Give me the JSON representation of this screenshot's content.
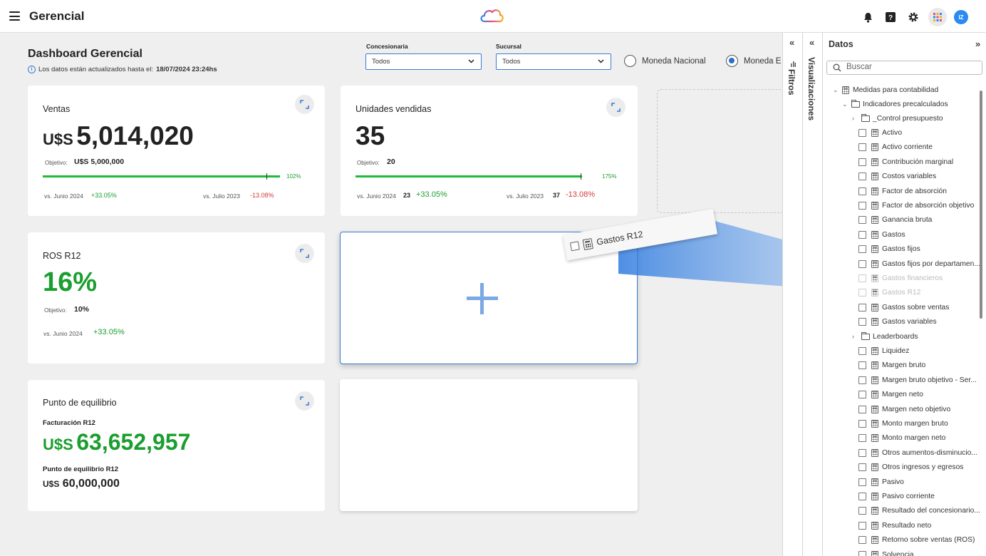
{
  "topbar": {
    "title": "Gerencial",
    "avatar": "IZ"
  },
  "header": {
    "title": "Dashboard Gerencial",
    "updated_prefix": "Los datos están actualizados hasta el:",
    "updated_date": "18/07/2024 23:24hs",
    "filters": [
      {
        "label": "Concesionaria",
        "value": "Todos"
      },
      {
        "label": "Sucursal",
        "value": "Todos"
      }
    ],
    "currency": [
      {
        "label": "Moneda Nacional",
        "selected": false
      },
      {
        "label": "Moneda E",
        "selected": true
      }
    ]
  },
  "cards": {
    "ventas": {
      "title": "Ventas",
      "currency": "U$S",
      "value": "5,014,020",
      "objective_label": "Objetivo:",
      "objective": "U$S 5,000,000",
      "progress_label": "102%",
      "progress": 1.02,
      "cmp1_label": "vs. Junio 2024",
      "cmp1_delta": "+33.05%",
      "cmp2_label": "vs. Julio 2023",
      "cmp2_delta": "-13.08%"
    },
    "unidades": {
      "title": "Unidades vendidas",
      "value": "35",
      "objective_label": "Objetivo:",
      "objective": "20",
      "progress_label": "175%",
      "progress": 1.75,
      "cmp1_label": "vs. Junio 2024",
      "cmp1_value": "23",
      "cmp1_delta": "+33.05%",
      "cmp2_label": "vs. Julio 2023",
      "cmp2_value": "37",
      "cmp2_delta": "-13.08%"
    },
    "ros": {
      "title": "ROS R12",
      "value": "16%",
      "objective_label": "Objetivo:",
      "objective": "10%",
      "cmp1_label": "vs. Junio 2024",
      "cmp1_delta": "+33.05%"
    },
    "equilibrio": {
      "title": "Punto de equilibrio",
      "sub1": "Facturación R12",
      "currency": "U$S",
      "value1": "63,652,957",
      "sub2": "Punto de equilibrio R12",
      "value2": "60,000,000"
    }
  },
  "drag_item": "Gastos R12",
  "panes": {
    "filtros": "Filtros",
    "visualizaciones": "Visualizaciones"
  },
  "datos": {
    "title": "Datos",
    "search_placeholder": "Buscar",
    "root": "Medidas para contabilidad",
    "folder": "Indicadores precalculados",
    "items": [
      {
        "type": "folder",
        "label": "_Control presupuesto"
      },
      {
        "type": "measure",
        "label": "Activo"
      },
      {
        "type": "measure",
        "label": "Activo corriente"
      },
      {
        "type": "measure",
        "label": "Contribución marginal"
      },
      {
        "type": "measure",
        "label": "Costos variables"
      },
      {
        "type": "measure",
        "label": "Factor de absorción"
      },
      {
        "type": "measure",
        "label": "Factor de absorción objetivo"
      },
      {
        "type": "measure",
        "label": "Ganancia bruta"
      },
      {
        "type": "measure",
        "label": "Gastos"
      },
      {
        "type": "measure",
        "label": "Gastos fijos"
      },
      {
        "type": "measure",
        "label": "Gastos fijos por departamen..."
      },
      {
        "type": "measure",
        "label": "Gastos financieros",
        "dim": true
      },
      {
        "type": "measure",
        "label": "Gastos R12",
        "dim": true
      },
      {
        "type": "measure",
        "label": "Gastos sobre ventas"
      },
      {
        "type": "measure",
        "label": "Gastos variables"
      },
      {
        "type": "folder",
        "label": "Leaderboards"
      },
      {
        "type": "measure",
        "label": "Liquidez"
      },
      {
        "type": "measure",
        "label": "Margen bruto"
      },
      {
        "type": "measure",
        "label": "Margen bruto objetivo - Ser..."
      },
      {
        "type": "measure",
        "label": "Margen neto"
      },
      {
        "type": "measure",
        "label": "Margen neto objetivo"
      },
      {
        "type": "measure",
        "label": "Monto margen bruto"
      },
      {
        "type": "measure",
        "label": "Monto margen neto"
      },
      {
        "type": "measure",
        "label": "Otros aumentos-disminucio..."
      },
      {
        "type": "measure",
        "label": "Otros ingresos y egresos"
      },
      {
        "type": "measure",
        "label": "Pasivo"
      },
      {
        "type": "measure",
        "label": "Pasivo corriente"
      },
      {
        "type": "measure",
        "label": "Resultado del concesionario..."
      },
      {
        "type": "measure",
        "label": "Resultado neto"
      },
      {
        "type": "measure",
        "label": "Retorno sobre ventas (ROS)"
      },
      {
        "type": "measure",
        "label": "Solvencia"
      }
    ]
  },
  "colors": {
    "accent": "#3a7bd5",
    "positive": "#1a9e2e",
    "negative": "#d43a3a",
    "bar": "#1dbb3a"
  }
}
